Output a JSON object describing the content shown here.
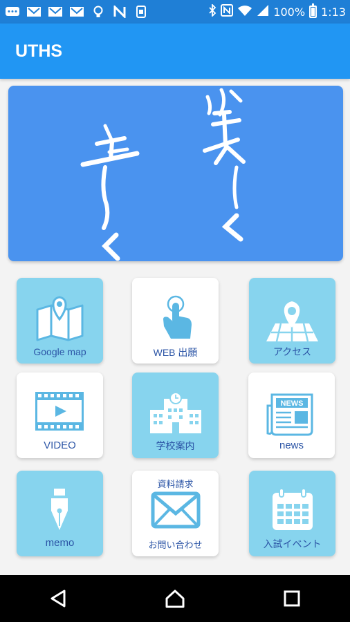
{
  "status_bar": {
    "battery_percent": "100%",
    "time": "1:13",
    "left_icons": [
      "message-icon",
      "gmail-icon",
      "gmail-icon",
      "gmail-icon",
      "bulb-icon",
      "n-app-icon",
      "sim-icon"
    ],
    "right_icons": [
      "bluetooth-icon",
      "nfc-icon",
      "wifi-icon",
      "signal-icon",
      "battery-icon"
    ]
  },
  "app_bar": {
    "title": "UTHS"
  },
  "menu": [
    {
      "label": "Google map",
      "icon": "map-pin-icon"
    },
    {
      "label": "WEB 出願",
      "icon": "touch-icon"
    },
    {
      "label": "アクセス",
      "icon": "location-map-icon"
    },
    {
      "label": "VIDEO",
      "icon": "video-icon"
    },
    {
      "label": "学校案内",
      "icon": "school-building-icon"
    },
    {
      "label": "news",
      "icon": "newspaper-icon"
    },
    {
      "label": "memo",
      "icon": "fountain-pen-icon"
    },
    {
      "label_top": "資料請求",
      "label": "お問い合わせ",
      "icon": "envelope-icon"
    },
    {
      "label": "入試イベント",
      "icon": "calendar-icon"
    }
  ],
  "colors": {
    "status_bar": "#1f7fd6",
    "app_bar": "#2196f3",
    "banner": "#4a93ef",
    "tile_cyan": "#87d4ee",
    "tile_white": "#ffffff",
    "icon_blue": "#5bb7e3",
    "label_blue": "#2c55a6"
  },
  "nav_bar": {
    "icons": [
      "back-icon",
      "home-icon",
      "recents-icon"
    ]
  }
}
